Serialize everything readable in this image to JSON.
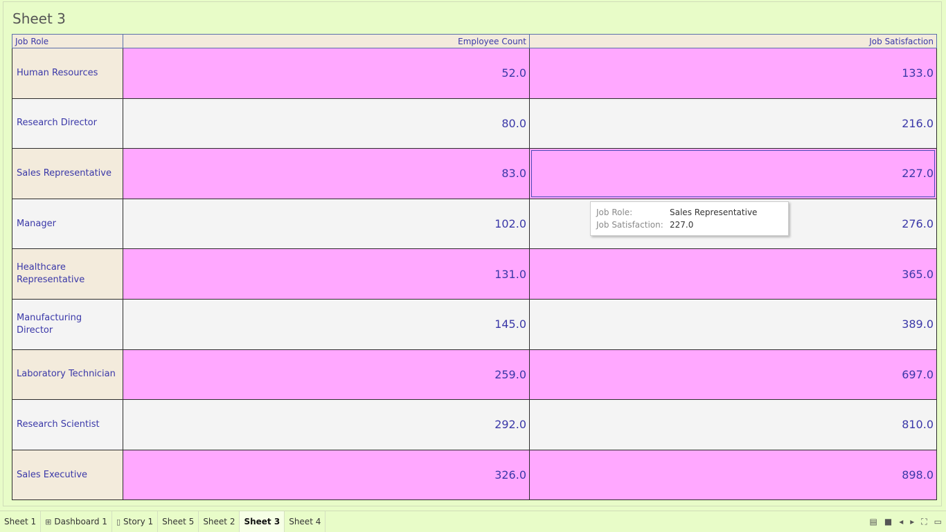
{
  "sheet": {
    "title": "Sheet 3"
  },
  "table": {
    "headers": {
      "role": "Job Role",
      "employee_count": "Employee Count",
      "job_satisfaction": "Job Satisfaction"
    },
    "rows": [
      {
        "role": "Human Resources",
        "employee_count": "52.0",
        "job_satisfaction": "133.0"
      },
      {
        "role": "Research Director",
        "employee_count": "80.0",
        "job_satisfaction": "216.0"
      },
      {
        "role": "Sales Representative",
        "employee_count": "83.0",
        "job_satisfaction": "227.0"
      },
      {
        "role": "Manager",
        "employee_count": "102.0",
        "job_satisfaction": "276.0"
      },
      {
        "role": "Healthcare Representative",
        "employee_count": "131.0",
        "job_satisfaction": "365.0"
      },
      {
        "role": "Manufacturing Director",
        "employee_count": "145.0",
        "job_satisfaction": "389.0"
      },
      {
        "role": "Laboratory Technician",
        "employee_count": "259.0",
        "job_satisfaction": "697.0"
      },
      {
        "role": "Research Scientist",
        "employee_count": "292.0",
        "job_satisfaction": "810.0"
      },
      {
        "role": "Sales Executive",
        "employee_count": "326.0",
        "job_satisfaction": "898.0"
      }
    ]
  },
  "tooltip": {
    "role_label": "Job Role:",
    "role_value": "Sales Representative",
    "sat_label": "Job Satisfaction:",
    "sat_value": "227.0"
  },
  "tabs": [
    {
      "label": "Sheet 1",
      "icon": "",
      "active": false
    },
    {
      "label": "Dashboard 1",
      "icon": "dashboard-icon",
      "active": false
    },
    {
      "label": "Story 1",
      "icon": "story-icon",
      "active": false
    },
    {
      "label": "Sheet 5",
      "icon": "",
      "active": false
    },
    {
      "label": "Sheet 2",
      "icon": "",
      "active": false
    },
    {
      "label": "Sheet 3",
      "icon": "",
      "active": true
    },
    {
      "label": "Sheet 4",
      "icon": "",
      "active": false
    }
  ],
  "colors": {
    "background": "#e8fcc8",
    "band_pink": "#ffa8ff",
    "band_gray": "#f4f4f4",
    "header_fill": "#f3ebdc",
    "text_blue": "#3a38a8"
  }
}
